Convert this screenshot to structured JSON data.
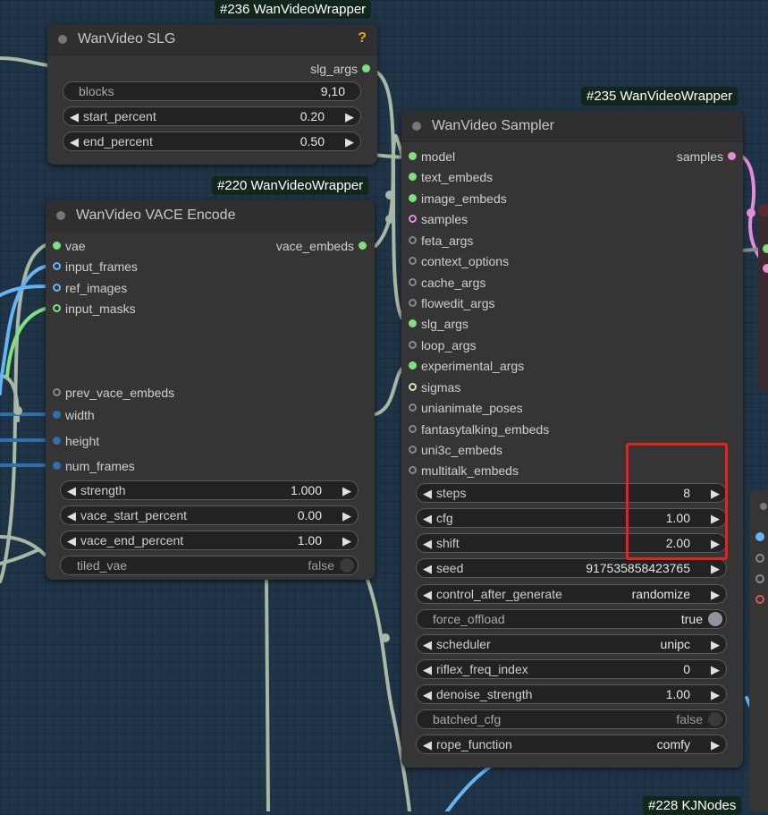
{
  "badges": {
    "slg": "#236 WanVideoWrapper",
    "sampler": "#235 WanVideoWrapper",
    "vace": "#220 WanVideoWrapper",
    "kj": "#228 KJNodes"
  },
  "slg_node": {
    "title": "WanVideo SLG",
    "warning_icon": "?",
    "output": "slg_args",
    "widgets": [
      {
        "label": "blocks",
        "value": "9,10"
      },
      {
        "label": "start_percent",
        "value": "0.20"
      },
      {
        "label": "end_percent",
        "value": "0.50"
      }
    ]
  },
  "vace_node": {
    "title": "WanVideo VACE Encode",
    "output": "vace_embeds",
    "inputs": [
      "vae",
      "input_frames",
      "ref_images",
      "input_masks",
      "prev_vace_embeds",
      "width",
      "height",
      "num_frames"
    ],
    "widgets": [
      {
        "label": "strength",
        "value": "1.000"
      },
      {
        "label": "vace_start_percent",
        "value": "0.00"
      },
      {
        "label": "vace_end_percent",
        "value": "1.00"
      },
      {
        "label": "tiled_vae",
        "value": "false"
      }
    ]
  },
  "sampler_node": {
    "title": "WanVideo Sampler",
    "output": "samples",
    "inputs": [
      "model",
      "text_embeds",
      "image_embeds",
      "samples",
      "feta_args",
      "context_options",
      "cache_args",
      "flowedit_args",
      "slg_args",
      "loop_args",
      "experimental_args",
      "sigmas",
      "unianimate_poses",
      "fantasytalking_embeds",
      "uni3c_embeds",
      "multitalk_embeds"
    ],
    "widgets": [
      {
        "label": "steps",
        "value": "8"
      },
      {
        "label": "cfg",
        "value": "1.00"
      },
      {
        "label": "shift",
        "value": "2.00"
      },
      {
        "label": "seed",
        "value": "917535858423765"
      },
      {
        "label": "control_after_generate",
        "value": "randomize"
      },
      {
        "label": "force_offload",
        "value": "true"
      },
      {
        "label": "scheduler",
        "value": "unipc"
      },
      {
        "label": "riflex_freq_index",
        "value": "0"
      },
      {
        "label": "denoise_strength",
        "value": "1.00"
      },
      {
        "label": "batched_cfg",
        "value": "false"
      },
      {
        "label": "rope_function",
        "value": "comfy"
      }
    ]
  },
  "colors": {
    "canvas": "#1f3447",
    "node_body": "#353535",
    "wire": "#a9b8a4",
    "highlight": "#e8201e",
    "slot_green": "#7fe07f",
    "slot_blue": "#64b5f6",
    "slot_pink": "#e58bd9"
  }
}
